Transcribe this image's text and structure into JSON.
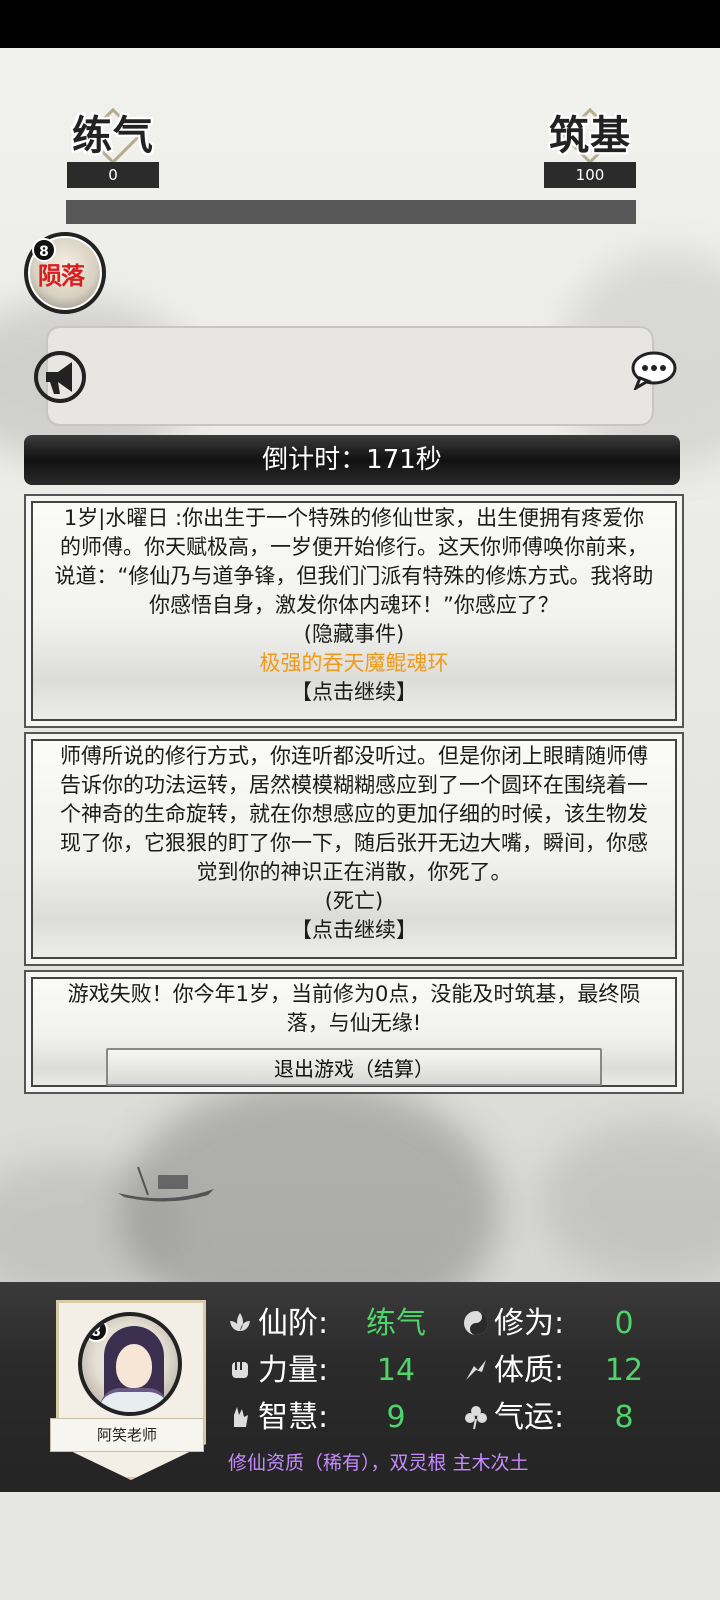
{
  "header": {
    "current_realm": {
      "name": "练气",
      "value": "0"
    },
    "next_realm": {
      "name": "筑基",
      "value": "100"
    },
    "progress_fraction": 0
  },
  "fallen_avatar": {
    "level": "8",
    "status": "陨落"
  },
  "countdown": {
    "text": "倒计时：171秒"
  },
  "events": [
    {
      "text": "1岁|水曜日 :你出生于一个特殊的修仙世家，出生便拥有疼爱你的师傅。你天赋极高，一岁便开始修行。这天你师傅唤你前来，说道：“修仙乃与道争锋，但我们门派有特殊的修炼方式。我将助你感悟自身，激发你体内魂环！”你感应了？",
      "tag": "(隐藏事件)",
      "highlight": "极强的吞天魔鲲魂环",
      "continue": "【点击继续】"
    },
    {
      "text": "师傅所说的修行方式，你连听都没听过。但是你闭上眼睛随师傅告诉你的功法运转，居然模模糊糊感应到了一个圆环在围绕着一个神奇的生命旋转，就在你想感应的更加仔细的时候，该生物发现了你，它狠狠的盯了你一下，随后张开无边大嘴，瞬间，你感觉到你的神识正在消散，你死了。",
      "tag": "(死亡)",
      "continue": "【点击继续】"
    }
  ],
  "result": {
    "text": "游戏失败！你今年1岁，当前修为0点，没能及时筑基，最终陨落，与仙无缘!",
    "exit_button": "退出游戏（结算）"
  },
  "character": {
    "level": "8",
    "name": "阿笑老师",
    "stats": {
      "realm_label": "仙阶:",
      "realm_value": "练气",
      "cultivation_label": "修为:",
      "cultivation_value": "0",
      "strength_label": "力量:",
      "strength_value": "14",
      "constitution_label": "体质:",
      "constitution_value": "12",
      "wisdom_label": "智慧:",
      "wisdom_value": "9",
      "luck_label": "气运:",
      "luck_value": "8"
    },
    "aptitude": "修仙资质（稀有），双灵根 主木次土"
  },
  "colors": {
    "stat_value": "#4fd469",
    "highlight": "#f09a1a",
    "aptitude": "#c78bff",
    "fallen": "#d81e1e"
  },
  "icons": [
    "megaphone-icon",
    "chat-bubble-icon",
    "lotus-icon",
    "yin-yang-icon",
    "fist-icon",
    "body-icon",
    "hand-icon",
    "clover-icon"
  ]
}
